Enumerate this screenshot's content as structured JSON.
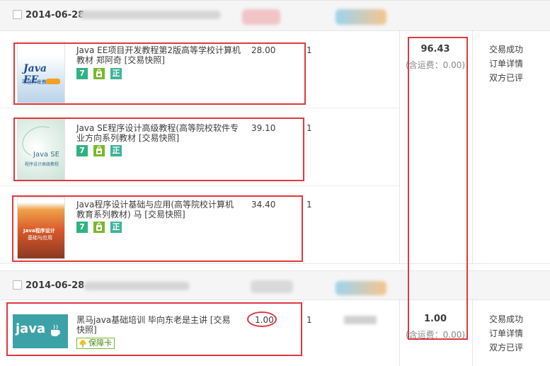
{
  "orders": [
    {
      "date": "2014-06-28",
      "items": [
        {
          "title": "Java EE项目开发教程第2版高等学校计算机教材 郑阿奇 [交易快照]",
          "price": "28.00",
          "qty": "1",
          "cover_text": "Java EE",
          "cover_sub": "项目开发教程"
        },
        {
          "title": "Java SE程序设计高级教程(高等院校软件专业方向系列教材 [交易快照]",
          "price": "39.10",
          "qty": "1",
          "cover_text": "Java SE",
          "cover_sub": "程序设计高级教程"
        },
        {
          "title": "Java程序设计基础与应用(高等院校计算机教育系列教材) 马 [交易快照]",
          "price": "34.40",
          "qty": "1",
          "cover_text": "Java程序设计",
          "cover_sub": "基础与应用"
        }
      ],
      "total": "96.43",
      "shipping": "(含运费：0.00)",
      "status": [
        "交易成功",
        "订单详情",
        "双方已评"
      ]
    },
    {
      "date": "2014-06-28",
      "items": [
        {
          "title": "黑马java基础培训 毕向东老是主讲 [交易快照]",
          "price": "1.00",
          "qty": "1",
          "cover_text": "java",
          "badge": "保障卡"
        }
      ],
      "total": "1.00",
      "shipping": "(含运费：0.00)",
      "status": [
        "交易成功",
        "订单详情",
        "双方已评"
      ]
    }
  ],
  "badges": {
    "seven": "7",
    "zheng": "正"
  },
  "colors": {
    "highlight": "#e0383e",
    "header_bg": "#f5f5f5",
    "badge_seven": "#2fb382",
    "badge_zheng": "#3fb39b",
    "badge_shop": "#7ab82a"
  }
}
